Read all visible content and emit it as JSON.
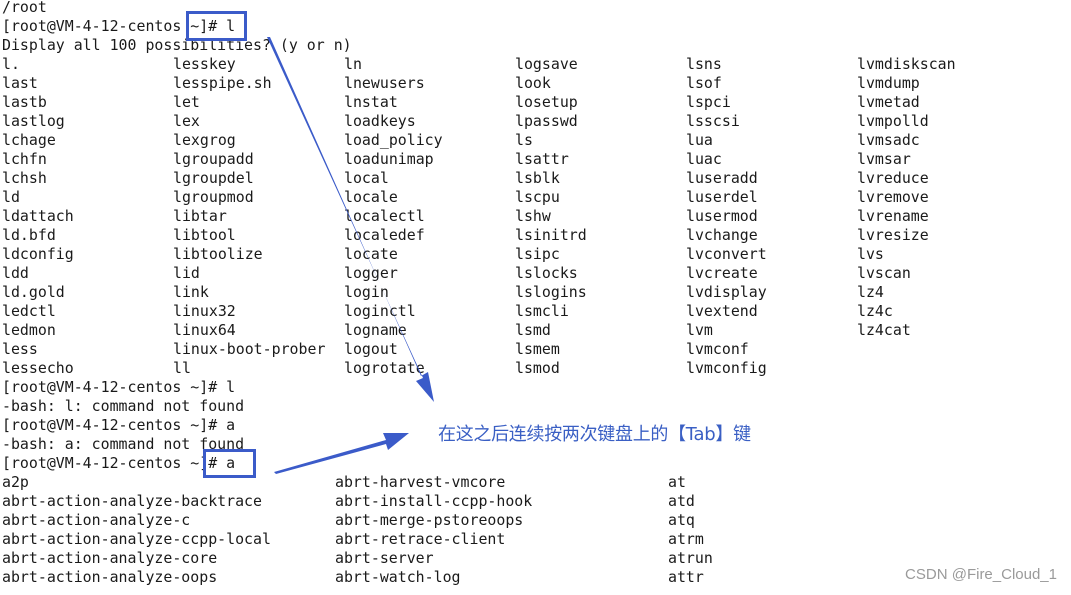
{
  "terminal": {
    "pre_lines": [
      "/root",
      "[root@VM-4-12-centos ~]# l",
      "Display all 100 possibilities? (y or n)"
    ],
    "completion_l": {
      "columns": [
        [
          "l.",
          "last",
          "lastb",
          "lastlog",
          "lchage",
          "lchfn",
          "lchsh",
          "ld",
          "ldattach",
          "ld.bfd",
          "ldconfig",
          "ldd",
          "ld.gold",
          "ledctl",
          "ledmon",
          "less",
          "lessecho"
        ],
        [
          "lesskey",
          "lesspipe.sh",
          "let",
          "lex",
          "lexgrog",
          "lgroupadd",
          "lgroupdel",
          "lgroupmod",
          "libtar",
          "libtool",
          "libtoolize",
          "lid",
          "link",
          "linux32",
          "linux64",
          "linux-boot-prober",
          "ll"
        ],
        [
          "ln",
          "lnewusers",
          "lnstat",
          "loadkeys",
          "load_policy",
          "loadunimap",
          "local",
          "locale",
          "localectl",
          "localedef",
          "locate",
          "logger",
          "login",
          "loginctl",
          "logname",
          "logout",
          "logrotate"
        ],
        [
          "logsave",
          "look",
          "losetup",
          "lpasswd",
          "ls",
          "lsattr",
          "lsblk",
          "lscpu",
          "lshw",
          "lsinitrd",
          "lsipc",
          "lslocks",
          "lslogins",
          "lsmcli",
          "lsmd",
          "lsmem",
          "lsmod"
        ],
        [
          "lsns",
          "lsof",
          "lspci",
          "lsscsi",
          "lua",
          "luac",
          "luseradd",
          "luserdel",
          "lusermod",
          "lvchange",
          "lvconvert",
          "lvcreate",
          "lvdisplay",
          "lvextend",
          "lvm",
          "lvmconf",
          "lvmconfig"
        ],
        [
          "lvmdiskscan",
          "lvmdump",
          "lvmetad",
          "lvmpolld",
          "lvmsadc",
          "lvmsar",
          "lvreduce",
          "lvremove",
          "lvrename",
          "lvresize",
          "lvs",
          "lvscan",
          "lz4",
          "lz4c",
          "lz4cat"
        ]
      ]
    },
    "mid_lines": [
      "[root@VM-4-12-centos ~]# l",
      "-bash: l: command not found",
      "[root@VM-4-12-centos ~]# a",
      "-bash: a: command not found",
      "[root@VM-4-12-centos ~]# a"
    ],
    "completion_a": {
      "columns": [
        [
          "a2p",
          "abrt-action-analyze-backtrace",
          "abrt-action-analyze-c",
          "abrt-action-analyze-ccpp-local",
          "abrt-action-analyze-core",
          "abrt-action-analyze-oops"
        ],
        [
          "abrt-harvest-vmcore",
          "abrt-install-ccpp-hook",
          "abrt-merge-pstoreoops",
          "abrt-retrace-client",
          "abrt-server",
          "abrt-watch-log"
        ],
        [
          "at",
          "atd",
          "atq",
          "atrm",
          "atrun",
          "attr"
        ]
      ]
    }
  },
  "annotation": {
    "text": "在这之后连续按两次键盘上的【Tab】键",
    "color": "#3a5fc4",
    "highlight_color": "#3b5bc9"
  },
  "watermark": "CSDN @Fire_Cloud_1"
}
